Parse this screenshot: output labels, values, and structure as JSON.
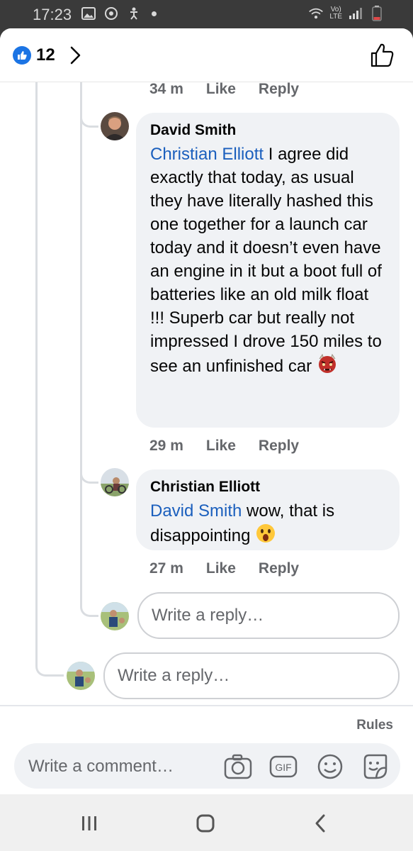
{
  "status_bar": {
    "time": "17:23",
    "lte_top": "Vo)",
    "lte_bottom": "LTE"
  },
  "header": {
    "like_count": "12"
  },
  "comments": [
    {
      "time": "34 m",
      "like_label": "Like",
      "reply_label": "Reply"
    },
    {
      "author": "David Smith",
      "mention": "Christian Elliott",
      "text": " I agree did exactly that today, as usual they have literally hashed this one together for a launch car today and it doesn’t even have an engine in it but a boot full of batteries like an old milk float !!! Superb car but really not impressed I drove 150 miles to see an unfinished car",
      "time": "29 m",
      "like_label": "Like",
      "reply_label": "Reply"
    },
    {
      "author": "Christian Elliott",
      "mention": "David Smith",
      "text": " wow, that is disappointing",
      "time": "27 m",
      "like_label": "Like",
      "reply_label": "Reply"
    }
  ],
  "reply_inputs": {
    "nested_placeholder": "Write a reply…",
    "outer_placeholder": "Write a reply…"
  },
  "footer": {
    "rules_label": "Rules",
    "comment_placeholder": "Write a comment…",
    "gif_label": "GIF"
  },
  "colors": {
    "accent_blue": "#1b74e4",
    "mention_blue": "#1b5fbd",
    "bubble_bg": "#f0f2f5",
    "meta_gray": "#65676b"
  }
}
